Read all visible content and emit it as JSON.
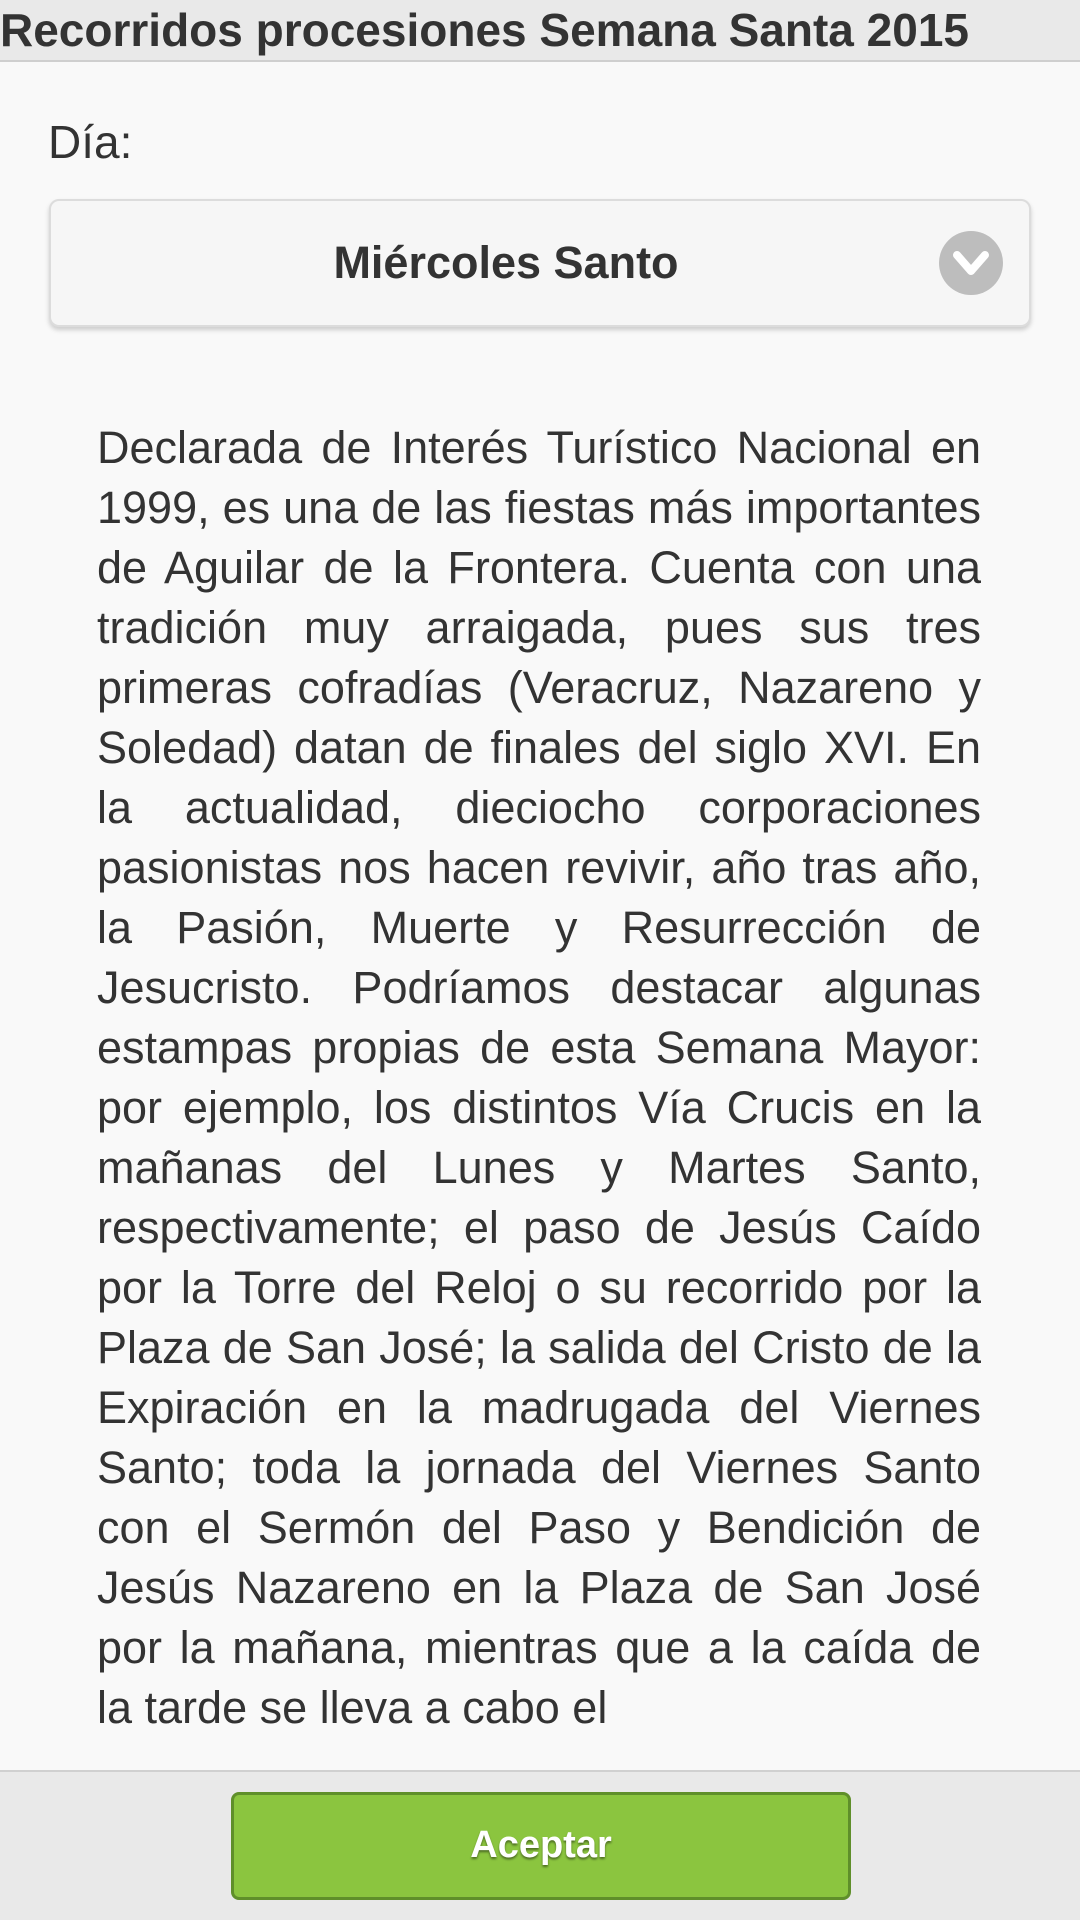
{
  "header": {
    "title": "Recorridos procesiones Semana Santa 2015"
  },
  "form": {
    "day_label": "Día:",
    "day_select": {
      "selected": "Miércoles Santo",
      "icon": "chevron-down-icon"
    }
  },
  "content": {
    "text": "Declarada de Interés Turístico Nacional en 1999, es una de las fiestas más importantes de Aguilar de la Frontera. Cuenta con una tradición muy arraigada, pues sus tres primeras cofradías (Veracruz, Nazareno y Soledad) datan de finales del siglo XVI. En la actualidad, dieciocho corporaciones pasionistas nos hacen revivir, año tras año, la Pasión, Muerte y Resurrección de Jesucristo. Podríamos destacar algunas estampas propias de esta Semana Mayor: por ejemplo, los distintos Vía Crucis en la mañanas del Lunes y Martes Santo, respectivamente; el paso de Jesús Caído por la Torre del Reloj o su recorrido por la Plaza de San José; la salida del Cristo de la Expiración en la madrugada del Viernes Santo; toda la jornada del Viernes Santo con el Sermón del Paso y Bendición de Jesús Nazareno en la Plaza de San José por la mañana, mientras que a la caída de la tarde se lleva a cabo el"
  },
  "footer": {
    "accept_label": "Aceptar"
  },
  "colors": {
    "accent": "#8bc53f",
    "accent_border": "#5f8f2a",
    "header_bg": "#e9e9e9",
    "page_bg": "#f9f9f9",
    "text": "#333333",
    "icon_bg": "#bdbdbd"
  }
}
